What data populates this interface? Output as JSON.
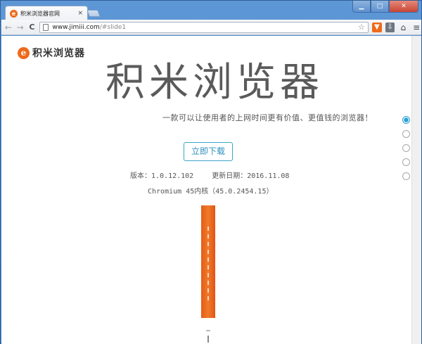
{
  "window": {
    "tab_title": "积米浏览器官网",
    "tab_close": "×",
    "controls": {
      "minimize": "▁",
      "maximize": "□",
      "close": "✕"
    }
  },
  "toolbar": {
    "back": "←",
    "forward": "→",
    "reload": "C",
    "url_host": "www.jimiii.com",
    "url_path": "/#slide1",
    "star": "☆",
    "home": "⌂",
    "menu": "≡"
  },
  "page": {
    "logo_mark": "e",
    "logo_text": "积米浏览器",
    "hero_title": "积米浏览器",
    "tagline": "一款可以让使用者的上网时间更有价值、更值钱的浏览器！",
    "download_label": "立即下载",
    "version_label": "版本：1.0.12.102",
    "update_label": "更新日期：2016.11.08",
    "core_label": "Chromium 45内核（45.0.2454.15）"
  },
  "slides": {
    "count": 5,
    "active_index": 0
  },
  "colors": {
    "brand_orange": "#ee6a1a",
    "accent_blue": "#2aa0d4"
  }
}
